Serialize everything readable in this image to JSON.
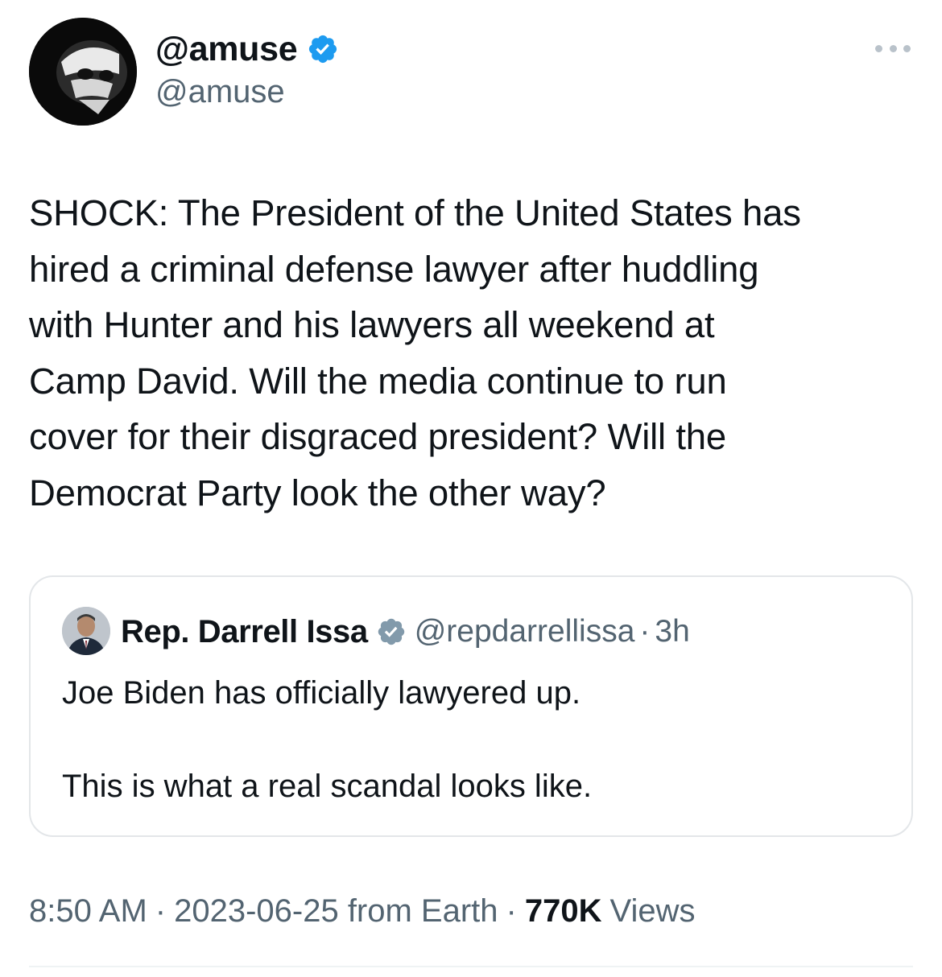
{
  "author": {
    "display_name": "@amuse",
    "handle": "@amuse",
    "verified": true
  },
  "tweet": {
    "text": "SHOCK: The President of the United States has\nhired a criminal defense lawyer after huddling\nwith Hunter and his lawyers all weekend at\nCamp David. Will the media continue to run\ncover for their disgraced president? Will the\nDemocrat Party look the other way?"
  },
  "quote": {
    "display_name": "Rep. Darrell Issa",
    "handle": "@repdarrellissa",
    "separator": "·",
    "time": "3h",
    "verified": true,
    "text": "Joe Biden has officially lawyered up.\n\nThis is what a real scandal looks like."
  },
  "meta": {
    "time": "8:50 AM",
    "separator": "·",
    "date_source": "2023-06-25 from Earth",
    "views_count": "770K",
    "views_label": "Views"
  },
  "colors": {
    "verified_blue": "#1d9bf0",
    "verified_gray": "#829aab",
    "secondary_text": "#536471",
    "primary_text": "#0f1419",
    "border": "#e3e6e9"
  }
}
